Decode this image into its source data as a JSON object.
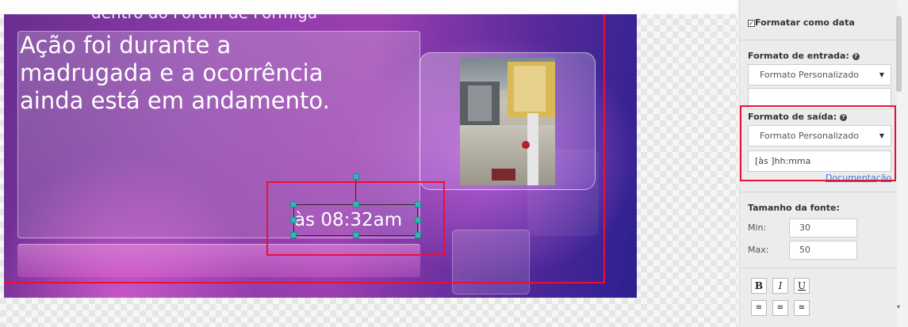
{
  "slide": {
    "top_text": "dentro do Fórum de Formiga",
    "headline_lines": [
      "Ação foi durante a",
      "madrugada e a ocorrência",
      "ainda está em andamento."
    ],
    "time_text": "às 08:32am"
  },
  "panel": {
    "format_as_date": {
      "label": "Formatar como data",
      "checked": true
    },
    "input_format": {
      "label": "Formato de entrada:",
      "help_icon": "question-circle-icon",
      "selected": "Formato Personalizado",
      "value": ""
    },
    "output_format": {
      "label": "Formato de saída:",
      "help_icon": "question-circle-icon",
      "selected": "Formato Personalizado",
      "value": "[às ]hh:mma",
      "doc_link": "Documentação"
    },
    "font_size": {
      "label": "Tamanho da fonte:",
      "min_label": "Min:",
      "min_value": "30",
      "max_label": "Max:",
      "max_value": "50"
    },
    "text_style": {
      "bold": "B",
      "italic": "I",
      "underline": "U",
      "align_left_icon": "align-left-icon",
      "align_center_icon": "align-center-icon",
      "align_right_icon": "align-right-icon"
    }
  },
  "colors": {
    "accent_highlight": "#e8103a",
    "handle": "#30b6b3",
    "slide_purple": "#8a3ca8"
  }
}
